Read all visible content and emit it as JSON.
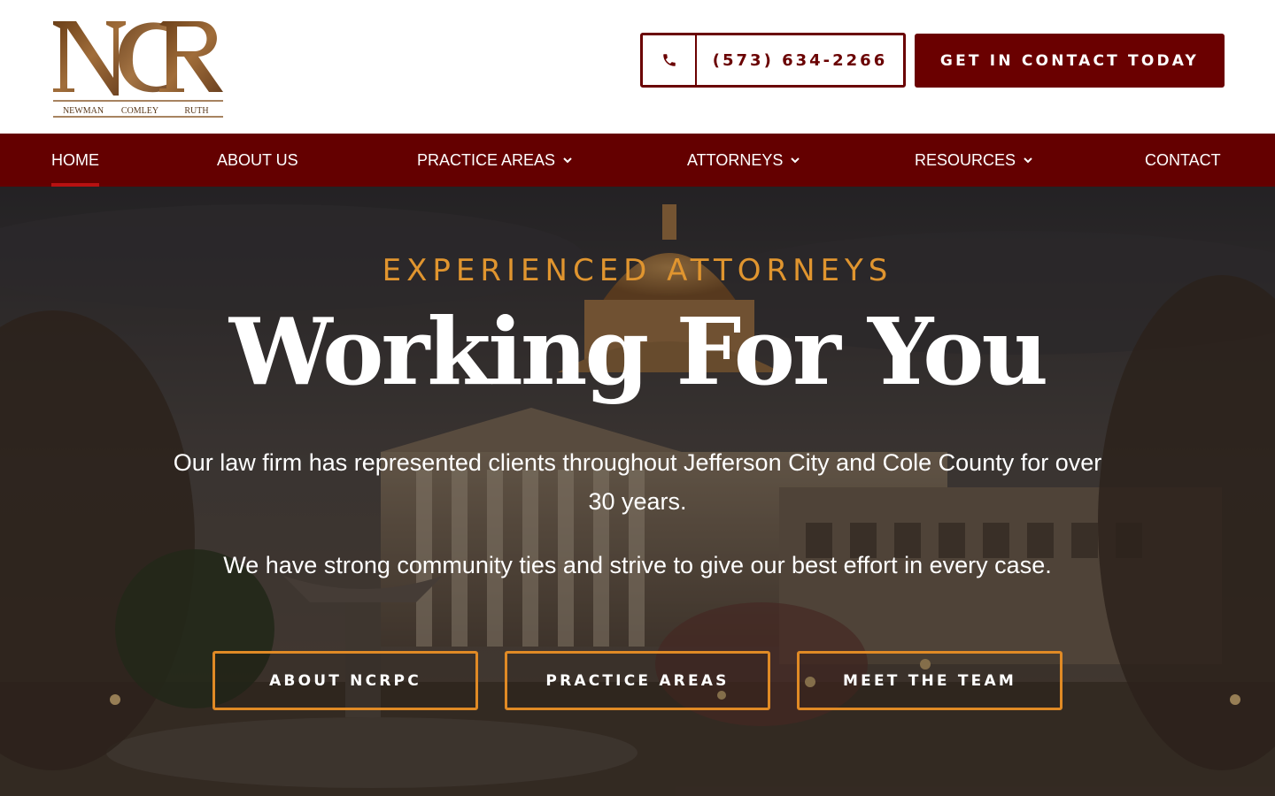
{
  "header": {
    "logo_monogram": "NCR",
    "logo_names": [
      "NEWMAN",
      "COMLEY",
      "RUTH"
    ],
    "phone_icon": "phone-icon",
    "phone_number": "(573) 634-2266",
    "cta_label": "GET IN CONTACT TODAY"
  },
  "nav": {
    "items": [
      {
        "label": "HOME",
        "active": true
      },
      {
        "label": "ABOUT US"
      },
      {
        "label": "PRACTICE AREAS",
        "has_dropdown": true
      },
      {
        "label": "ATTORNEYS",
        "has_dropdown": true
      },
      {
        "label": "RESOURCES",
        "has_dropdown": true
      },
      {
        "label": "CONTACT"
      }
    ]
  },
  "hero": {
    "eyebrow": "EXPERIENCED ATTORNEYS",
    "headline": "Working For You",
    "paragraph1": "Our law firm has represented clients throughout Jefferson City and Cole County for over 30 years.",
    "paragraph2": "We have strong community ties and strive to give our best effort in every case.",
    "buttons": [
      {
        "label": "ABOUT NCRPC"
      },
      {
        "label": "PRACTICE AREAS"
      },
      {
        "label": "MEET THE TEAM"
      }
    ]
  },
  "colors": {
    "brand_maroon": "#6a0000",
    "nav_bg": "#640000",
    "accent_orange": "#e0952f",
    "logo_bronze": "#8a5a2b"
  }
}
